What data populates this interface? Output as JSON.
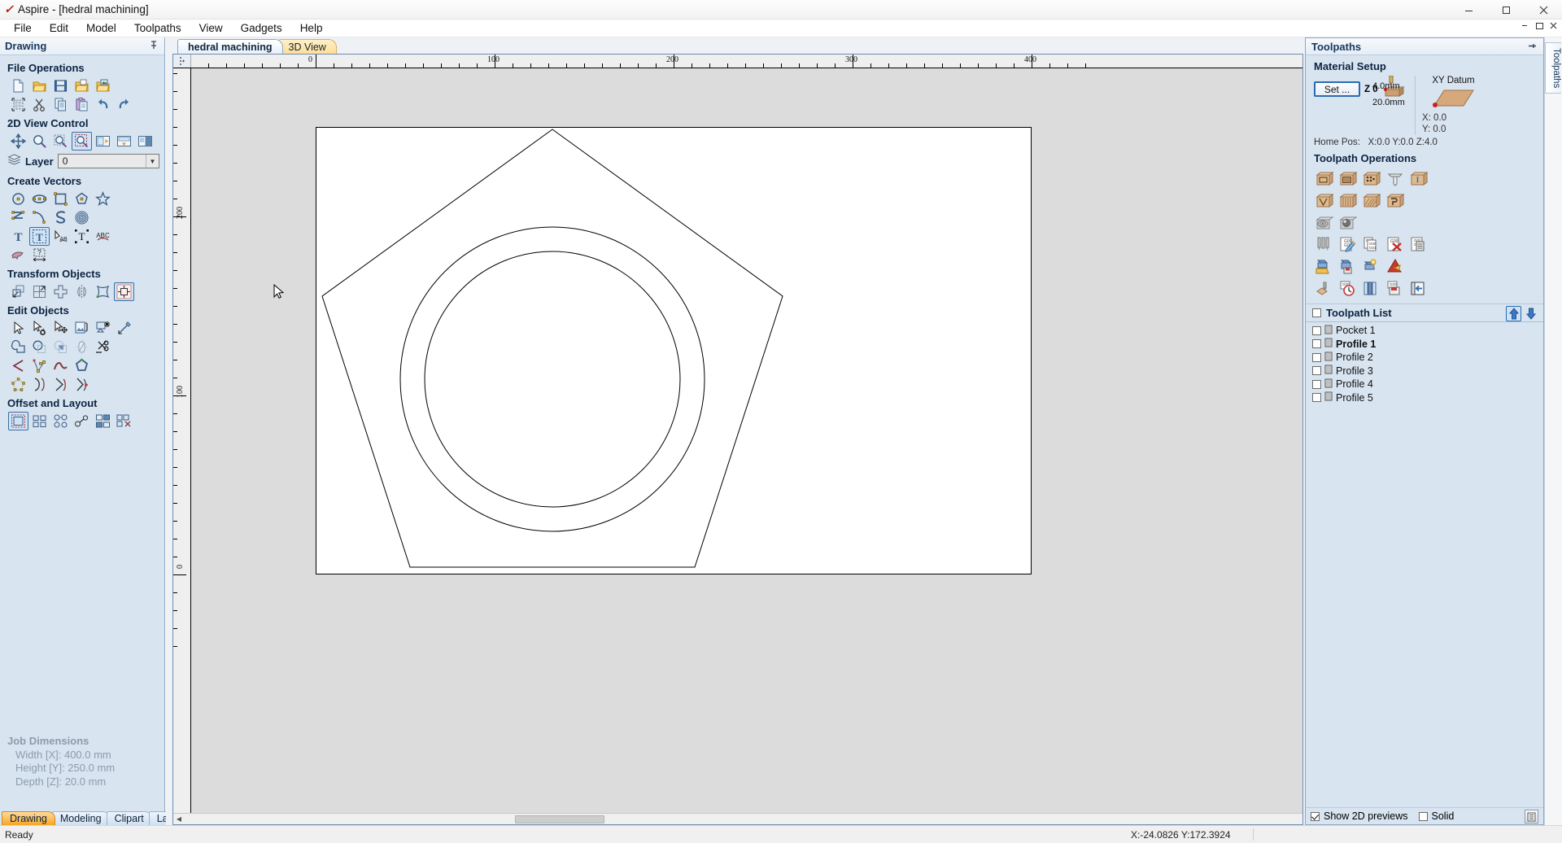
{
  "window": {
    "app_name": "Aspire",
    "title": "Aspire - [hedral machining]",
    "app_icon": "brush-icon",
    "minimize": "minimize-icon",
    "maximize": "maximize-icon",
    "close": "close-icon"
  },
  "menu": {
    "items": [
      "File",
      "Edit",
      "Model",
      "Toolpaths",
      "View",
      "Gadgets",
      "Help"
    ],
    "doc_restore": "restore-doc-icon",
    "doc_close": "close-doc-icon"
  },
  "left_panel": {
    "header": "Drawing",
    "pin_icon": "pin-icon",
    "groups": [
      {
        "title": "File Operations",
        "rows": [
          [
            "new-file-icon",
            "open-folder-icon",
            "save-disk-icon",
            "open-recent-icon",
            "import-vectors-icon"
          ],
          [
            "job-setup-icon",
            "cut-scissors-icon",
            "copy-icon",
            "paste-icon",
            "undo-icon",
            "redo-icon"
          ]
        ]
      },
      {
        "title": "2D View Control",
        "rows": [
          [
            "pan-icon",
            "zoom-icon",
            "zoom-selected-icon",
            "zoom-box-icon",
            "zoom-to-drawing-icon",
            "zoom-to-job-icon",
            "split-view-icon"
          ]
        ]
      },
      {
        "title": "Create Vectors",
        "rows": [
          [
            "circle-icon",
            "ellipse-icon",
            "rectangle-icon",
            "polygon-icon",
            "star-icon"
          ],
          [
            "polyline-icon",
            "arc-icon",
            "curve-icon",
            "spiral-icon"
          ],
          [
            "text-icon",
            "text-box-icon",
            "text-on-curve-icon",
            "text-selection-icon",
            "text-arc-icon"
          ],
          [
            "trace-bitmap-icon",
            "dimension-icon"
          ]
        ]
      },
      {
        "title": "Transform Objects",
        "rows": [
          [
            "move-icon",
            "scale-icon",
            "rotate-icon",
            "mirror-icon",
            "distort-icon",
            "align-icon"
          ]
        ]
      },
      {
        "title": "Edit Objects",
        "rows": [
          [
            "select-icon",
            "node-edit-icon",
            "move-nodes-icon",
            "group-icon",
            "ungroup-icon",
            "measure-icon"
          ],
          [
            "weld-icon",
            "subtract-icon",
            "intersect-icon",
            "fillet-icon",
            "trim-icon"
          ],
          [
            "join-vectors-icon",
            "node-points-icon",
            "smooth-curve-icon",
            "close-vector-icon"
          ],
          [
            "create-shape-icon",
            "insert-node-icon",
            "curve-to-line-icon",
            "node-tools-icon"
          ]
        ]
      },
      {
        "title": "Offset and Layout",
        "rows": [
          [
            "offset-icon",
            "array-copy-icon",
            "block-copy-icon",
            "nest-icon",
            "copy-along-curve-icon",
            "nesting-tools-icon"
          ]
        ]
      }
    ],
    "layer": {
      "label": "Layer",
      "icon": "layers-icon",
      "value": "0",
      "dropdown_icon": "chevron-down-icon"
    },
    "job_dimensions": {
      "title": "Job Dimensions",
      "lines": [
        "Width  [X]: 400.0 mm",
        "Height [Y]: 250.0 mm",
        "Depth  [Z]: 20.0 mm"
      ]
    },
    "tabs": [
      {
        "label": "Drawing",
        "active": true
      },
      {
        "label": "Modeling",
        "active": false
      },
      {
        "label": "Clipart",
        "active": false
      },
      {
        "label": "Layers",
        "active": false
      }
    ]
  },
  "document_tabs": [
    {
      "label": "hedral machining",
      "active": true
    },
    {
      "label": "3D View",
      "active": false
    }
  ],
  "canvas": {
    "ruler_h_labels": [
      "0",
      "100",
      "200",
      "300",
      "400"
    ],
    "ruler_v_labels": [
      "200",
      "100",
      "0"
    ],
    "corner_icon": "ruler-origin-icon",
    "cursor_icon": "mouse-pointer-icon",
    "scroll_left_icon": "scroll-left-icon",
    "scroll_right_icon": "scroll-right-icon"
  },
  "right_panel": {
    "header": "Toolpaths",
    "pin_icon": "pin-icon",
    "material_setup": {
      "title": "Material Setup",
      "set_button": "Set ...",
      "z_label": "Z 0",
      "above_thickness": "4.0mm",
      "material_thickness": "20.0mm",
      "home_pos_label": "Home Pos:",
      "home_pos_value": "X:0.0 Y:0.0 Z:4.0",
      "block_icon": "material-block-icon"
    },
    "xy_datum": {
      "title": "XY Datum",
      "icon": "xy-datum-plane-icon",
      "x": "X: 0.0",
      "y": "Y: 0.0"
    },
    "toolpath_operations": {
      "title": "Toolpath Operations",
      "rows": [
        [
          "profile-toolpath-icon",
          "pocket-toolpath-icon",
          "drilling-toolpath-icon",
          "fluting-toolpath-icon",
          "inlay-toolpath-icon"
        ],
        [
          "vcarve-toolpath-icon",
          "prism-carving-icon",
          "texture-toolpath-icon",
          "moulding-toolpath-icon"
        ],
        [
          "3d-rough-toolpath-icon",
          "3d-finish-toolpath-icon"
        ],
        [
          "tool-database-icon",
          "edit-toolpath-icon",
          "duplicate-toolpath-icon",
          "delete-toolpath-icon",
          "toolpath-summary-icon"
        ],
        [
          "toolpath-template-open-icon",
          "save-template-icon",
          "template-wizard-icon",
          "merge-toolpaths-icon"
        ],
        [
          "preview-toolpath-icon",
          "estimate-time-icon",
          "toolpath-tiling-icon",
          "save-toolpath-icon",
          "toolpath-panel-icon"
        ]
      ]
    },
    "toolpath_list": {
      "title": "Toolpath List",
      "select_all_checked": false,
      "move_up_icon": "move-up-icon",
      "move_down_icon": "move-down-icon",
      "items": [
        {
          "label": "Pocket 1",
          "checked": false,
          "bold": false
        },
        {
          "label": "Profile 1",
          "checked": false,
          "bold": true
        },
        {
          "label": "Profile 2",
          "checked": false,
          "bold": false
        },
        {
          "label": "Profile 3",
          "checked": false,
          "bold": false
        },
        {
          "label": "Profile 4",
          "checked": false,
          "bold": false
        },
        {
          "label": "Profile 5",
          "checked": false,
          "bold": false
        }
      ],
      "item_icon": "toolpath-item-icon"
    },
    "footer": {
      "show_2d_previews_label": "Show 2D previews",
      "show_2d_previews_checked": true,
      "solid_label": "Solid",
      "solid_checked": false,
      "panel_icon": "list-view-icon"
    }
  },
  "vertical_tab": {
    "label": "Toolpaths"
  },
  "status_bar": {
    "message": "Ready",
    "coordinates": "X:-24.0826 Y:172.3924"
  },
  "colors": {
    "panel_bg": "#d8e4f0",
    "panel_border": "#8da9c4",
    "accent_blue": "#2b6cb0",
    "active_tab_orange": "#f5a623",
    "canvas_bg": "#dcdcdc",
    "material_white": "#ffffff",
    "vector_stroke": "#000000"
  }
}
